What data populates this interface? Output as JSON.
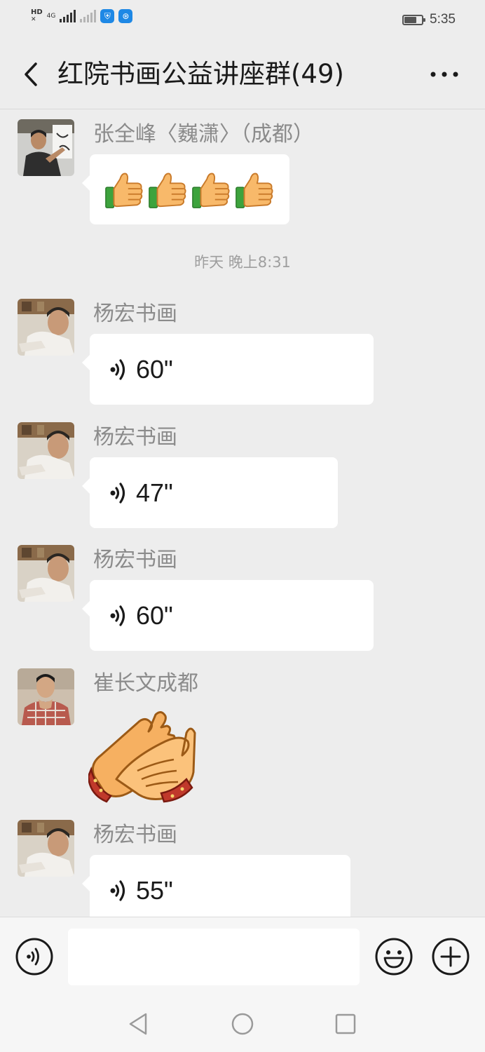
{
  "status_bar": {
    "hd_label": "HD",
    "network_label": "4G",
    "time": "5:35",
    "battery_level": 0.72
  },
  "header": {
    "title": "红院书画公益讲座群(49)",
    "back_icon": "chevron-left-icon",
    "more_icon": "more-dots-icon"
  },
  "messages": [
    {
      "sender": "张全峰〈巍潇〉（成都）",
      "type": "emoji",
      "content": "thumbs-up x4"
    },
    {
      "sender": "杨宏书画",
      "type": "voice",
      "duration": "60\""
    },
    {
      "sender": "杨宏书画",
      "type": "voice",
      "duration": "47\""
    },
    {
      "sender": "杨宏书画",
      "type": "voice",
      "duration": "60\""
    },
    {
      "sender": "崔长文成都",
      "type": "sticker",
      "content": "clapping-hands"
    },
    {
      "sender": "杨宏书画",
      "type": "voice",
      "duration": "55\""
    }
  ],
  "time_divider": "昨天 晚上8:31",
  "input_bar": {
    "voice_icon": "voice-input-icon",
    "emoji_icon": "emoji-icon",
    "plus_icon": "plus-icon",
    "placeholder": ""
  },
  "nav_bar": {
    "icons": [
      "nav-back-icon",
      "nav-home-icon",
      "nav-recents-icon"
    ]
  },
  "colors": {
    "background": "#ededed",
    "bubble": "#ffffff",
    "sender_text": "#8b8b8b",
    "divider_text": "#9e9e9e"
  }
}
